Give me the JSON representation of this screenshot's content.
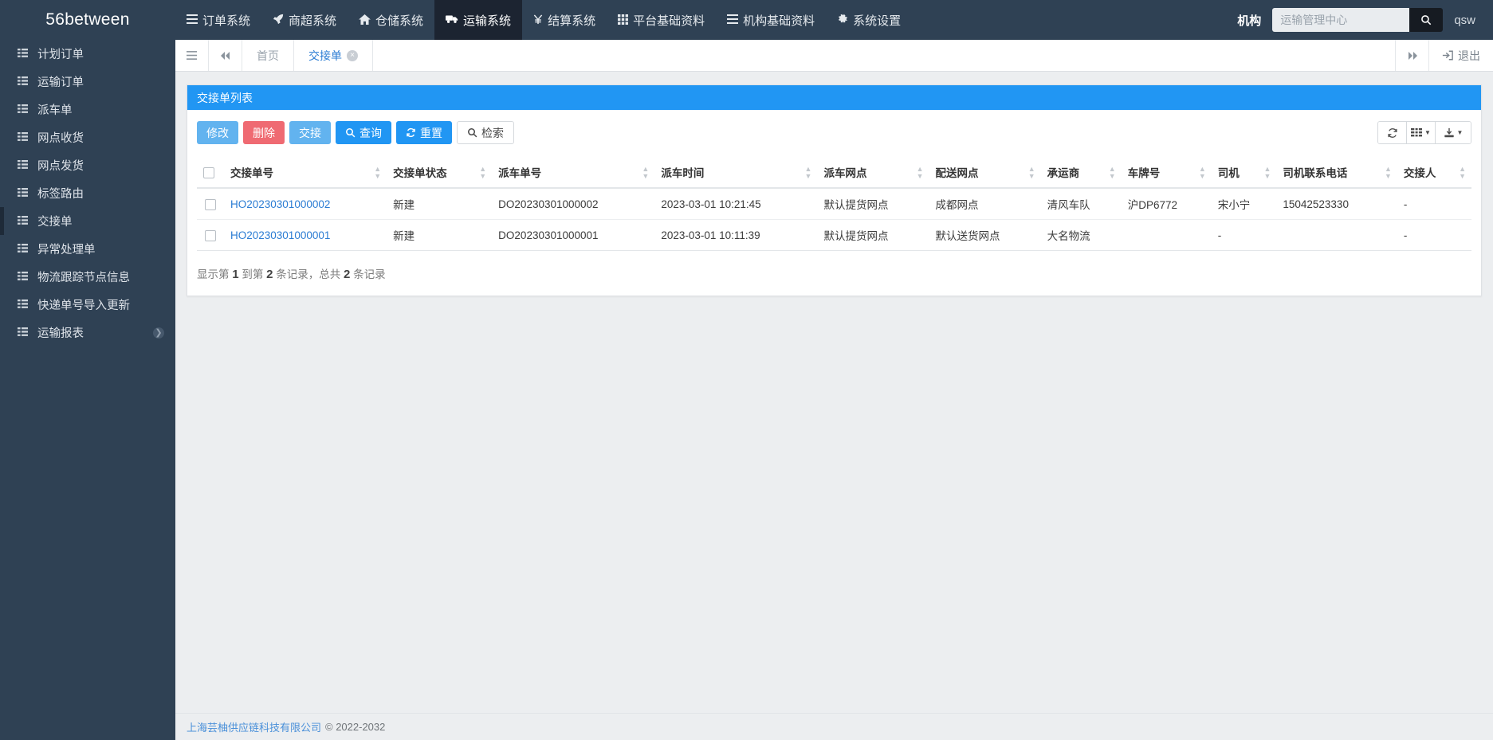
{
  "brand": "56between",
  "topnav": {
    "items": [
      {
        "label": "订单系统",
        "icon": "list-icon",
        "active": false
      },
      {
        "label": "商超系统",
        "icon": "rocket-icon",
        "active": false
      },
      {
        "label": "仓储系统",
        "icon": "home-icon",
        "active": false
      },
      {
        "label": "运输系统",
        "icon": "truck-icon",
        "active": true
      },
      {
        "label": "结算系统",
        "icon": "yen-icon",
        "active": false
      },
      {
        "label": "平台基础资料",
        "icon": "grid-icon",
        "active": false
      },
      {
        "label": "机构基础资料",
        "icon": "list-icon",
        "active": false
      },
      {
        "label": "系统设置",
        "icon": "gear-icon",
        "active": false
      }
    ],
    "org_label": "机构",
    "org_value": "运输管理中心",
    "org_placeholder": "运输管理中心",
    "search_icon": "search-icon",
    "user": "qsw"
  },
  "sidebar": {
    "items": [
      {
        "label": "计划订单",
        "active": false,
        "caret": false
      },
      {
        "label": "运输订单",
        "active": false,
        "caret": false
      },
      {
        "label": "派车单",
        "active": false,
        "caret": false
      },
      {
        "label": "网点收货",
        "active": false,
        "caret": false
      },
      {
        "label": "网点发货",
        "active": false,
        "caret": false
      },
      {
        "label": "标签路由",
        "active": false,
        "caret": false
      },
      {
        "label": "交接单",
        "active": true,
        "caret": false
      },
      {
        "label": "异常处理单",
        "active": false,
        "caret": false
      },
      {
        "label": "物流跟踪节点信息",
        "active": false,
        "caret": false
      },
      {
        "label": "快递单号导入更新",
        "active": false,
        "caret": false
      },
      {
        "label": "运输报表",
        "active": false,
        "caret": true
      }
    ]
  },
  "tabbar": {
    "menu_icon": "hamburger-icon",
    "prev_icon": "double-left-icon",
    "next_icon": "double-right-icon",
    "tabs": [
      {
        "label": "首页",
        "active": false,
        "closable": false
      },
      {
        "label": "交接单",
        "active": true,
        "closable": true
      }
    ],
    "logout_label": "退出",
    "logout_icon": "logout-icon"
  },
  "panel": {
    "title": "交接单列表",
    "accent_color": "#2196f3",
    "toolbar": [
      {
        "label": "修改",
        "style": "info",
        "icon": ""
      },
      {
        "label": "删除",
        "style": "danger",
        "icon": ""
      },
      {
        "label": "交接",
        "style": "info",
        "icon": ""
      },
      {
        "label": "查询",
        "style": "primary",
        "icon": "search-icon"
      },
      {
        "label": "重置",
        "style": "primary",
        "icon": "refresh-icon"
      },
      {
        "label": "检索",
        "style": "default",
        "icon": "search-icon"
      }
    ],
    "tools_right": [
      {
        "name": "refresh-icon",
        "caret": false
      },
      {
        "name": "columns-icon",
        "caret": true
      },
      {
        "name": "export-icon",
        "caret": true
      }
    ]
  },
  "table": {
    "columns": [
      "交接单号",
      "交接单状态",
      "派车单号",
      "派车时间",
      "派车网点",
      "配送网点",
      "承运商",
      "车牌号",
      "司机",
      "司机联系电话",
      "交接人"
    ],
    "rows": [
      {
        "交接单号": "HO20230301000002",
        "交接单状态": "新建",
        "派车单号": "DO20230301000002",
        "派车时间": "2023-03-01 10:21:45",
        "派车网点": "默认提货网点",
        "配送网点": "成都网点",
        "承运商": "清风车队",
        "车牌号": "沪DP6772",
        "司机": "宋小宁",
        "司机联系电话": "15042523330",
        "交接人": "-"
      },
      {
        "交接单号": "HO20230301000001",
        "交接单状态": "新建",
        "派车单号": "DO20230301000001",
        "派车时间": "2023-03-01 10:11:39",
        "派车网点": "默认提货网点",
        "配送网点": "默认送货网点",
        "承运商": "大名物流",
        "车牌号": "",
        "司机": "-",
        "司机联系电话": "",
        "交接人": "-"
      }
    ],
    "pager": {
      "prefix": "显示第",
      "from": "1",
      "mid": "到第",
      "to": "2",
      "suffix": "条记录，总共",
      "total": "2",
      "tail": "条记录"
    }
  },
  "footer": {
    "link": "上海芸柚供应链科技有限公司",
    "copyright": "© 2022-2032"
  }
}
